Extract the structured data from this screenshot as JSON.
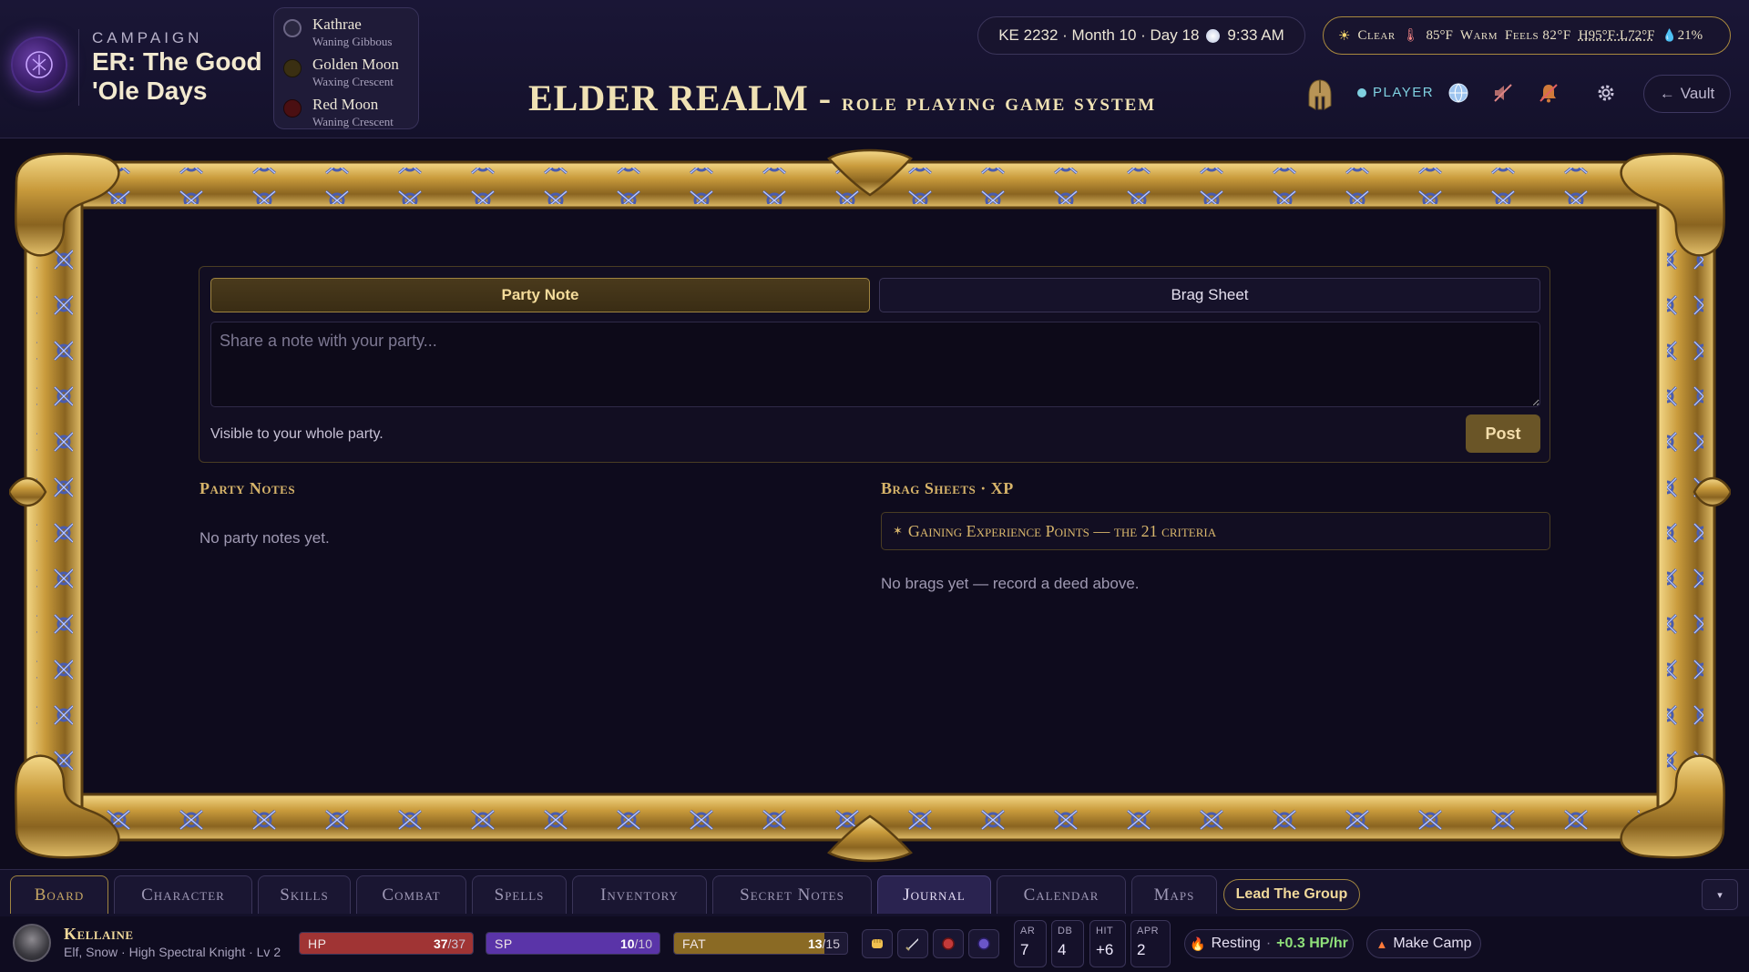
{
  "header": {
    "campaign_kicker": "CAMPAIGN",
    "campaign_name": "ER: The Good 'Ole Days",
    "moons": [
      {
        "name": "Kathrae",
        "phase": "Waning Gibbous",
        "color": "#2a2740"
      },
      {
        "name": "Golden Moon",
        "phase": "Waxing Crescent",
        "color": "#3a2f12"
      },
      {
        "name": "Red Moon",
        "phase": "Waning Crescent",
        "color": "#4a0f12"
      }
    ],
    "title_main": "ELDER REALM -",
    "title_sub": "role playing game system",
    "date_text": "KE 2232 · Month 10 · Day 18",
    "time_text": "9:33 AM",
    "weather": {
      "condition": "Clear",
      "temp": "85°F",
      "feel_word": "Warm",
      "feels": "Feels 82°F",
      "hilo": "H95°F·L72°F",
      "humidity": "21%"
    },
    "role_label": "PLAYER",
    "vault_label": "Vault"
  },
  "compose": {
    "tab_party": "Party Note",
    "tab_brag": "Brag Sheet",
    "placeholder": "Share a note with your party...",
    "hint": "Visible to your whole party.",
    "post_label": "Post"
  },
  "party_notes": {
    "title": "Party Notes",
    "empty": "No party notes yet."
  },
  "brag": {
    "title": "Brag Sheets · XP",
    "criteria": "Gaining Experience Points — the 21 criteria",
    "empty": "No brags yet — record a deed above."
  },
  "nav": {
    "tabs": [
      "Board",
      "Character",
      "Skills",
      "Combat",
      "Spells",
      "Inventory",
      "Secret Notes",
      "Journal",
      "Calendar",
      "Maps"
    ],
    "active": "Journal",
    "lead_label": "Lead The Group",
    "collapse_glyph": "▾"
  },
  "status": {
    "char_name": "Kellaine",
    "char_desc": "Elf, Snow · High Spectral Knight · Lv 2",
    "bars": [
      {
        "label": "HP",
        "value": "37",
        "max": "37",
        "fraction": 1.0,
        "color": "#a03434"
      },
      {
        "label": "SP",
        "value": "10",
        "max": "10",
        "fraction": 1.0,
        "color": "#5a34a8"
      },
      {
        "label": "FAT",
        "value": "13",
        "max": "15",
        "fraction": 0.8667,
        "color": "#8a6a24"
      }
    ],
    "stats": [
      {
        "label": "AR",
        "value": "7"
      },
      {
        "label": "DB",
        "value": "4"
      },
      {
        "label": "HIT",
        "value": "+6"
      },
      {
        "label": "APR",
        "value": "2"
      }
    ],
    "resting_label": "Resting",
    "regen": "+0.3 HP/hr",
    "camp_label": "Make Camp"
  },
  "colors": {
    "gold": "#d7b46a",
    "background": "#0e0b1d",
    "accent_purple": "#5a34a8"
  }
}
